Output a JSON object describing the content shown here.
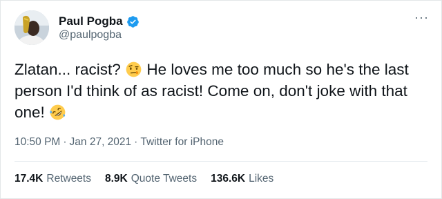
{
  "author": {
    "display_name": "Paul Pogba",
    "handle": "@paulpogba",
    "verified_icon": "verified-badge-icon",
    "avatar_icon": "avatar"
  },
  "more_label": "···",
  "tweet": {
    "line1_a": "Zlatan... racist?",
    "line1_b": " He loves me too much so he's the last person I'd think of as racist! Come on, don't joke with that one! ",
    "emoji_1": "face-with-raised-eyebrow-emoji",
    "emoji_2": "rolling-on-floor-laughing-emoji"
  },
  "meta": {
    "time": "10:50 PM",
    "sep1": "·",
    "date": "Jan 27, 2021",
    "sep2": "·",
    "source": "Twitter for iPhone"
  },
  "stats": {
    "retweets_count": "17.4K",
    "retweets_label": "Retweets",
    "quotes_count": "8.9K",
    "quotes_label": "Quote Tweets",
    "likes_count": "136.6K",
    "likes_label": "Likes"
  },
  "colors": {
    "text": "#0f1419",
    "secondary": "#536471",
    "verified": "#1d9bf0",
    "divider": "#e6ecf0"
  }
}
